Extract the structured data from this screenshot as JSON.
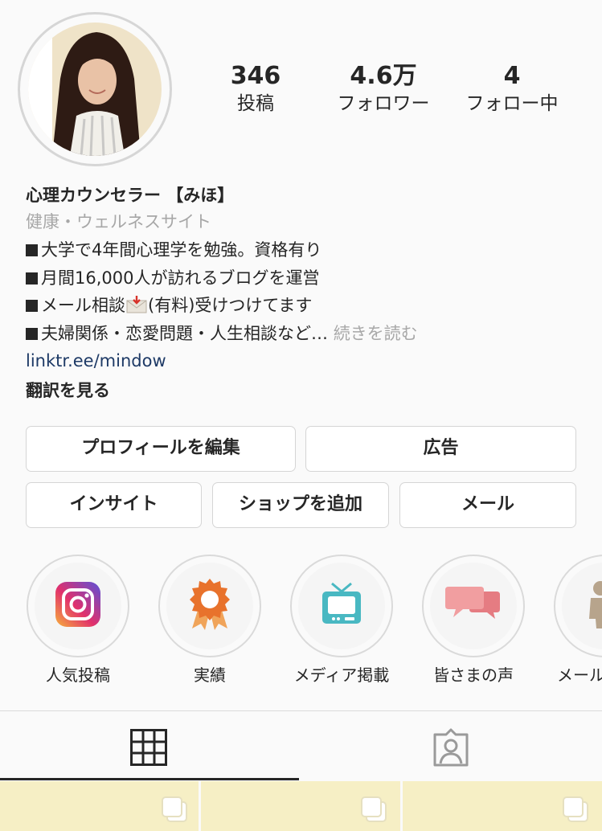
{
  "stats": {
    "posts": {
      "value": "346",
      "label": "投稿"
    },
    "followers": {
      "value": "4.6万",
      "label": "フォロワー"
    },
    "following": {
      "value": "4",
      "label": "フォロー中"
    }
  },
  "bio": {
    "name": "心理カウンセラー 【みほ】",
    "category": "健康・ウェルネスサイト",
    "lines": [
      "大学で4年間心理学を勉強。資格有り",
      "月間16,000人が訪れるブログを運営",
      "メール相談",
      "(有料)受けつけてます",
      "夫婦関係・恋愛問題・人生相談など…"
    ],
    "read_more": "続きを読む",
    "link": "linktr.ee/mindow",
    "translate": "翻訳を見る"
  },
  "buttons": {
    "edit_profile": "プロフィールを編集",
    "ads": "広告",
    "insights": "インサイト",
    "add_shop": "ショップを追加",
    "email": "メール"
  },
  "highlights": [
    {
      "label": "人気投稿",
      "icon": "instagram-icon"
    },
    {
      "label": "実績",
      "icon": "award-ribbon-icon"
    },
    {
      "label": "メディア掲載",
      "icon": "tv-icon"
    },
    {
      "label": "皆さまの声",
      "icon": "speech-bubbles-icon"
    },
    {
      "label": "メール",
      "icon": "person-icon"
    }
  ],
  "tabs": [
    {
      "name": "grid",
      "icon": "grid-icon",
      "active": true
    },
    {
      "name": "tagged",
      "icon": "tagged-person-icon",
      "active": false
    }
  ],
  "colors": {
    "link": "#1e3a66",
    "secondary_text": "#a7a7a7",
    "grid_tile": "#f6efc5"
  }
}
